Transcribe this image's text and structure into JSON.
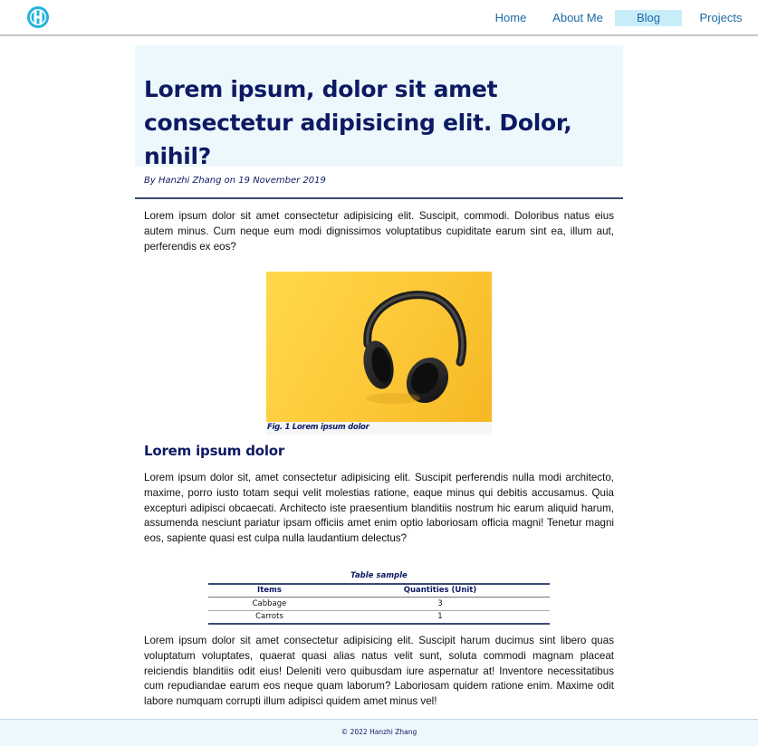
{
  "header": {
    "logo_letter": "H",
    "nav": [
      {
        "label": "Home"
      },
      {
        "label": "About Me"
      },
      {
        "label": "Blog",
        "active": true
      },
      {
        "label": "Projects"
      }
    ]
  },
  "article": {
    "title": "Lorem ipsum, dolor sit amet consectetur adipisicing elit. Dolor, nihil?",
    "byline": "By Hanzhi Zhang on 19 November 2019",
    "paragraph1": "Lorem ipsum dolor sit amet consectetur adipisicing elit. Suscipit, commodi. Doloribus natus eius autem minus. Cum neque eum modi dignissimos voluptatibus cupiditate earum sint ea, illum aut, perferendis ex eos?",
    "figure": {
      "image": "headphones-on-yellow-background",
      "caption": "Fig. 1 Lorem ipsum dolor"
    },
    "subheading": "Lorem ipsum dolor",
    "paragraph2": "Lorem ipsum dolor sit, amet consectetur adipisicing elit. Suscipit perferendis nulla modi architecto, maxime, porro iusto totam sequi velit molestias ratione, eaque minus qui debitis accusamus. Quia excepturi adipisci obcaecati. Architecto iste praesentium blanditiis nostrum hic earum aliquid harum, assumenda nesciunt pariatur ipsam officiis amet enim optio laboriosam officia magni! Tenetur magni eos, sapiente quasi est culpa nulla laudantium delectus?",
    "table": {
      "caption": "Table sample",
      "headers": [
        "Items",
        "Quantities (Unit)"
      ],
      "rows": [
        [
          "Cabbage",
          "3"
        ],
        [
          "Carrots",
          "1"
        ]
      ]
    },
    "paragraph3": "Lorem ipsum dolor sit amet consectetur adipisicing elit. Suscipit harum ducimus sint libero quas voluptatum voluptates, quaerat quasi alias natus velit sunt, soluta commodi magnam placeat reiciendis blanditiis odit eius! Deleniti vero quibusdam iure aspernatur at! Inventore necessitatibus cum repudiandae earum eos neque quam laborum? Laboriosam quidem ratione enim. Maxime odit labore numquam corrupti illum adipisci quidem amet minus vel!"
  },
  "footer": {
    "text": "© 2022 Hanzhi Zhang"
  },
  "colors": {
    "accent": "#1b6aa5",
    "title": "#0d1a63",
    "active_nav_bg": "#c9edf8",
    "title_bg": "#edf8fc",
    "logo": "#21b3dd"
  }
}
